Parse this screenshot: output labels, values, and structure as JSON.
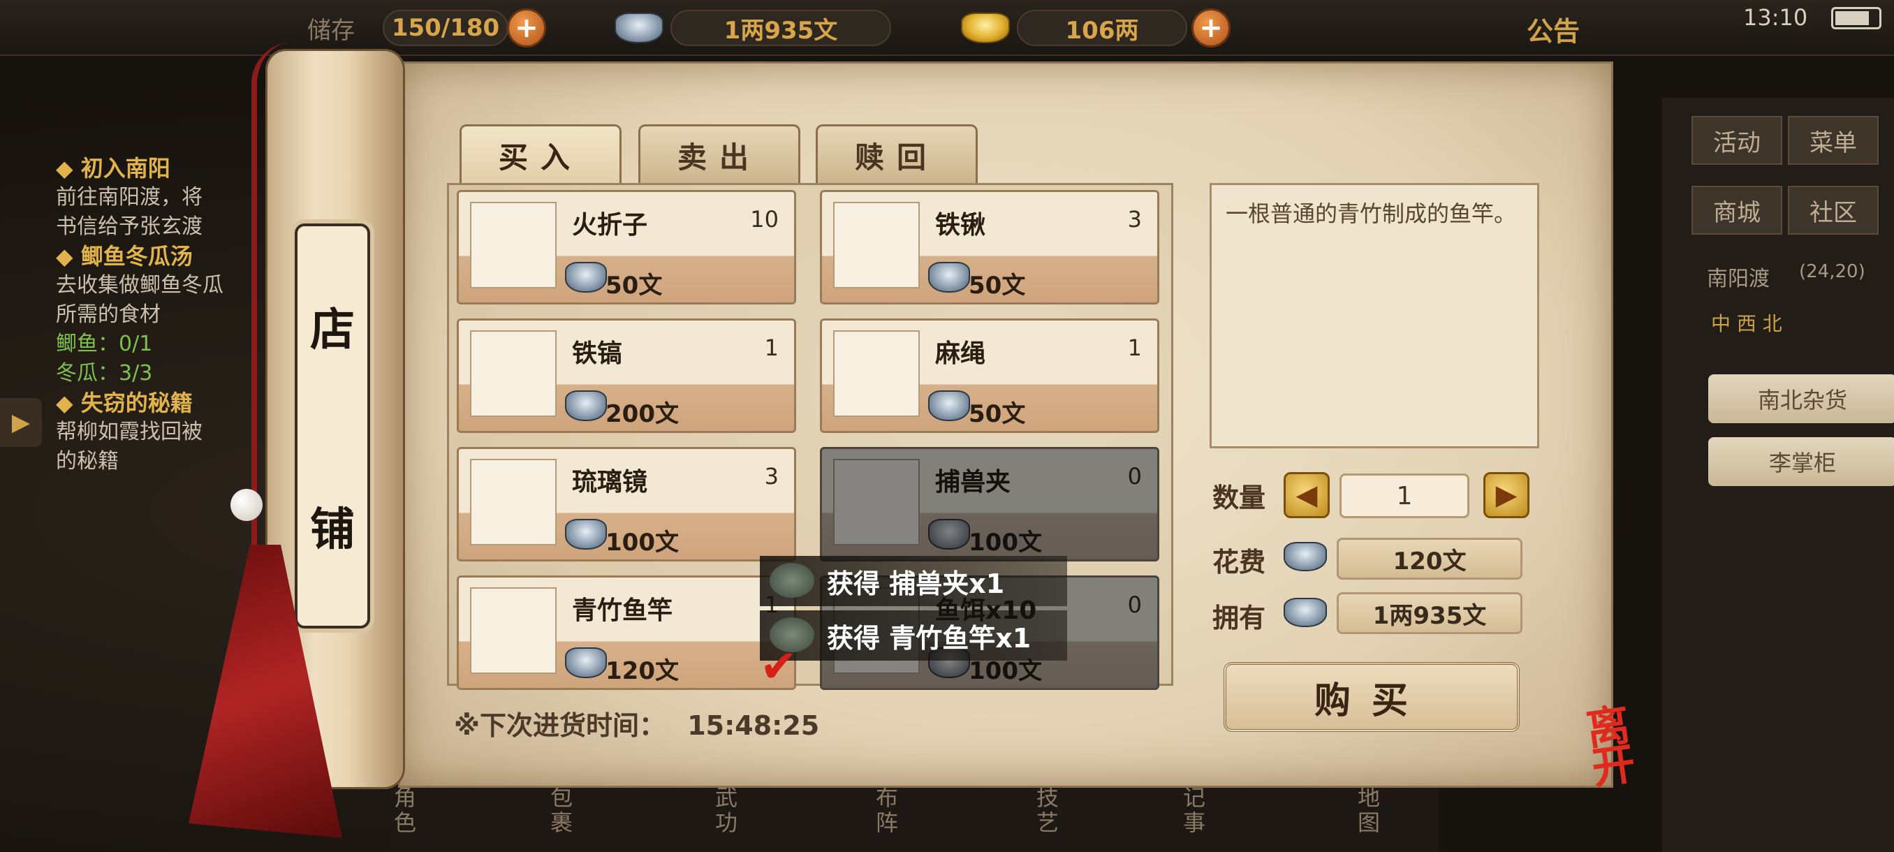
{
  "status_bar": {
    "time": "13:10",
    "battery_level": 0.8,
    "backpack_label": "储存",
    "backpack_capacity": "150/180",
    "silver": "1两935文",
    "gold": "106两",
    "notice_label": "公告"
  },
  "quests": [
    {
      "title": "初入南阳",
      "lines": [
        "前往南阳渡，将",
        "书信给予张玄渡"
      ]
    },
    {
      "title": "鲫鱼冬瓜汤",
      "lines": [
        "去收集做鲫鱼冬瓜",
        "所需的食材"
      ],
      "progress": [
        "鲫鱼：0/1",
        "冬瓜：3/3"
      ]
    },
    {
      "title": "失窃的秘籍",
      "lines": [
        "帮柳如霞找回被",
        "的秘籍"
      ]
    }
  ],
  "right_menu": {
    "buttons": [
      "活动",
      "菜单",
      "商城",
      "社区"
    ],
    "location": "南阳渡",
    "coords": "(24,20)",
    "compass": "中 西 北",
    "npcs": [
      "南北杂货",
      "李掌柜"
    ]
  },
  "bottom_nav": [
    "角色",
    "包裹",
    "武功",
    "布阵",
    "技艺",
    "记事",
    "地图"
  ],
  "shop": {
    "scroll_title": [
      "店",
      "铺"
    ],
    "tabs": [
      "买入",
      "卖出",
      "赎回"
    ],
    "active_tab": 0,
    "items": [
      {
        "name": "火折子",
        "count": "10",
        "price": "50文",
        "icon": "fire-starter-icon",
        "enabled": true
      },
      {
        "name": "铁锹",
        "count": "3",
        "price": "50文",
        "icon": "shovel-icon",
        "enabled": true
      },
      {
        "name": "铁镐",
        "count": "1",
        "price": "200文",
        "icon": "pickaxe-icon",
        "enabled": true
      },
      {
        "name": "麻绳",
        "count": "1",
        "price": "50文",
        "icon": "rope-icon",
        "enabled": true
      },
      {
        "name": "琉璃镜",
        "count": "3",
        "price": "100文",
        "icon": "spyglass-icon",
        "enabled": true
      },
      {
        "name": "捕兽夹",
        "count": "0",
        "price": "100文",
        "icon": "bear-trap-icon",
        "enabled": false
      },
      {
        "name": "青竹鱼竿",
        "count": "1",
        "price": "120文",
        "icon": "fishing-rod-icon",
        "enabled": true
      },
      {
        "name": "鱼饵x10",
        "count": "0",
        "price": "100文",
        "icon": "bait-icon",
        "enabled": false
      }
    ],
    "toasts": [
      "获得 捕兽夹x1",
      "获得 青竹鱼竿x1"
    ],
    "restock_label": "※下次进货时间：",
    "restock_time": "15:48:25",
    "description": "一根普通的青竹制成的鱼竿。",
    "quantity_label": "数量",
    "quantity": "1",
    "cost_label": "花费",
    "cost": "120文",
    "owned_label": "拥有",
    "owned": "1两935文",
    "buy_label": "购买",
    "leave_label": "离开"
  }
}
